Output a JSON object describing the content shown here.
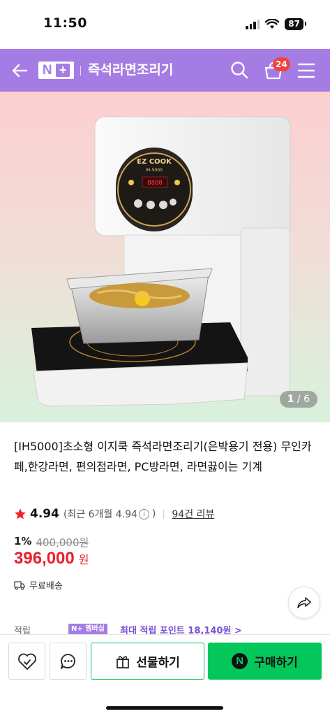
{
  "status_bar": {
    "time": "11:50",
    "battery": "87"
  },
  "header": {
    "logo_n": "N",
    "logo_plus": "+",
    "title": "즉석라면조리기",
    "cart_count": "24",
    "background_color": "#a57ce4"
  },
  "gallery": {
    "current": "1",
    "total": "/ 6"
  },
  "product": {
    "title": "[IH5000]초소형 이지쿡 즉석라면조리기(은박용기 전용) 무인카페,한강라면, 편의점라면, PC방라면, 라면끓이는 기계",
    "rating": "4.94",
    "rating_detail": "(최근 6개월 4.94",
    "rating_detail_close": ")",
    "reviews": "94건 리뷰",
    "discount_rate": "1%",
    "original_price": "400,000원",
    "final_price": "396,000",
    "currency": "원",
    "shipping": "무료배송",
    "points_label": "적립",
    "membership_badge": "N+ 멤버십",
    "points_text": "최대 적립 포인트 18,140원 >",
    "price_color": "#e8202a"
  },
  "bottom_bar": {
    "gift_label": "선물하기",
    "buy_label": "구매하기",
    "buy_color": "#03c75a"
  },
  "device": {
    "brand": "EZ COOK",
    "model": "IH-5000",
    "display": "8888"
  }
}
